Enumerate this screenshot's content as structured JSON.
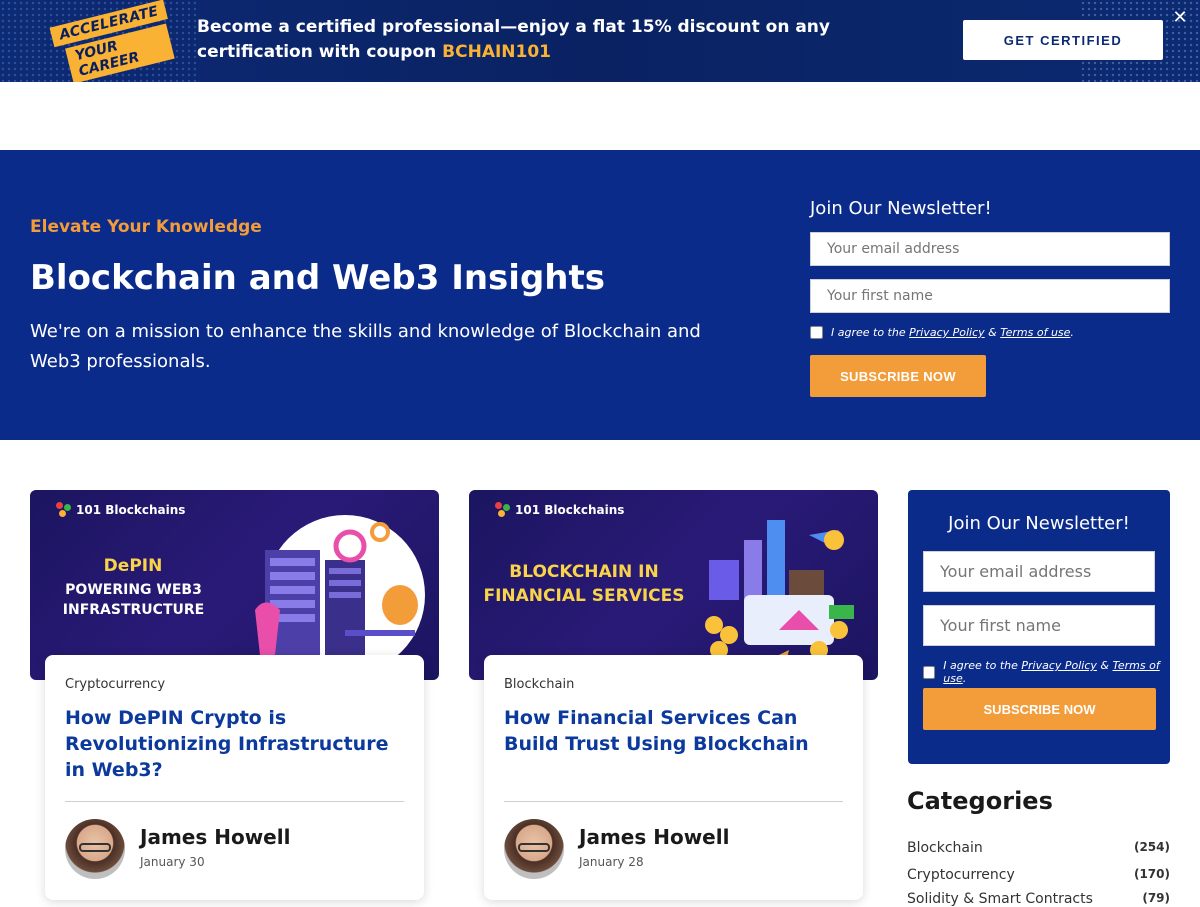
{
  "promo": {
    "badge_line1": "ACCELERATE",
    "badge_line2": "YOUR CAREER",
    "text": "Become a certified professional—enjoy a flat 15% discount on any certification with coupon ",
    "coupon": "BCHAIN101",
    "cta": "GET CERTIFIED",
    "close": "✕"
  },
  "hero": {
    "eyebrow": "Elevate Your Knowledge",
    "title": "Blockchain and Web3 Insights",
    "description": "We're on a mission to enhance the skills and knowledge of Blockchain and Web3 professionals.",
    "newsletter": {
      "title": "Join Our Newsletter!",
      "email_placeholder": "Your email address",
      "name_placeholder": "Your first name",
      "agree_prefix": "I agree to the ",
      "privacy": "Privacy Policy",
      "amp": " & ",
      "terms": "Terms of use",
      "period": ".",
      "button": "SUBSCRIBE NOW"
    }
  },
  "cards": [
    {
      "logo": "101 Blockchains",
      "thumb_line1": "DePIN",
      "thumb_line2": "POWERING WEB3",
      "thumb_line3": "INFRASTRUCTURE",
      "category": "Cryptocurrency",
      "title": "How DePIN Crypto is Revolutionizing Infrastructure in Web3?",
      "author": "James Howell",
      "date": "January 30"
    },
    {
      "logo": "101 Blockchains",
      "thumb_line1": "BLOCKCHAIN IN",
      "thumb_line2": "FINANCIAL SERVICES",
      "category": "Blockchain",
      "title": "How Financial Services Can Build Trust Using Blockchain",
      "author": "James Howell",
      "date": "January 28"
    }
  ],
  "sidebar": {
    "newsletter": {
      "title": "Join Our Newsletter!",
      "email_placeholder": "Your email address",
      "name_placeholder": "Your first name",
      "agree_prefix": "I agree to the ",
      "privacy": "Privacy Policy",
      "amp": " & ",
      "terms": "Terms of use",
      "period": ".",
      "button": "SUBSCRIBE NOW"
    },
    "categories_title": "Categories",
    "categories": [
      {
        "label": "Blockchain",
        "count": "(254)"
      },
      {
        "label": "Cryptocurrency",
        "count": "(170)"
      },
      {
        "label": "Solidity & Smart Contracts",
        "count": "(79)"
      }
    ]
  },
  "colors": {
    "navy": "#0b2b8a",
    "orange": "#f39c3a",
    "link_blue": "#0b3a9c",
    "promo_gold": "#f9b233"
  }
}
